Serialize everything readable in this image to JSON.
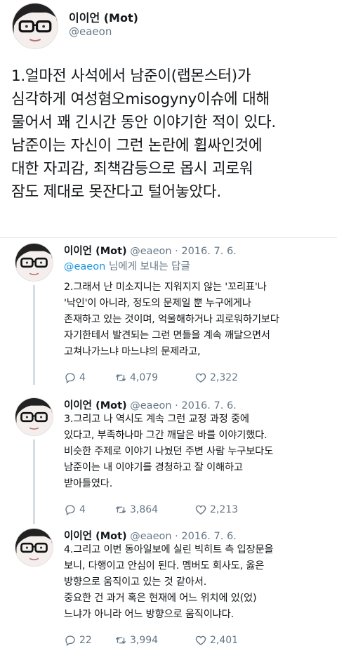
{
  "main": {
    "name": "이이언 (Mot)",
    "handle": "@eaeon",
    "text": "1.얼마전 사석에서 남준이(랩몬스터)가\n심각하게 여성혐오misogyny이슈에 대해\n물어서 꽤 긴시간 동안 이야기한 적이 있다.\n남준이는 자신이 그런 논란에 휩싸인것에\n대한 자괴감, 죄책감등으로 몹시 괴로워\n잠도 제대로 못잔다고 털어놓았다."
  },
  "replies": [
    {
      "name": "이이언 (Mot)",
      "meta": "@eaeon · 2016. 7. 6.",
      "reply_to_mention": "@eaeon",
      "reply_to_rest": " 님에게 보내는 답글",
      "text": "2.그래서 난 미소지니는 지워지지 않는 '꼬리표'나\n'낙인'이 아니라, 정도의 문제일 뿐 누구에게나\n존재하고 있는 것이며, 억울해하거나 괴로워하기보다\n자기한테서 발견되는 그런 면들을 계속 깨달으면서\n고쳐나가느냐 마느냐의 문제라고,",
      "replies_count": "4",
      "retweets": "4,079",
      "likes": "2,322"
    },
    {
      "name": "이이언 (Mot)",
      "meta": "@eaeon · 2016. 7. 6.",
      "text": "3.그리고 나 역시도 계속 그런 교정 과정 중에\n있다고, 부족하나마 그간 깨달은 바를 이야기했다.\n비슷한 주제로 이야기 나눴던 주변 사람 누구보다도\n남준이는 내 이야기를 경청하고 잘 이해하고\n받아들였다.",
      "replies_count": "4",
      "retweets": "3,864",
      "likes": "2,213"
    },
    {
      "name": "이이언 (Mot)",
      "meta": "@eaeon · 2016. 7. 6.",
      "text": "4.그리고 이번 동아일보에 실린 빅히트 측 입장문을\n보니, 다행이고 안심이 된다. 멤버도 회사도, 옳은\n방향으로 움직이고 있는 것 같아서.\n중요한 건 과거 혹은 현재에 어느 위치에 있(었)\n느냐가 아니라 어느 방향으로 움직이냐다.",
      "replies_count": "22",
      "retweets": "3,994",
      "likes": "2,401"
    }
  ],
  "colors": {
    "text": "#14171a",
    "muted": "#657786",
    "link": "#1b95e0",
    "divider": "#e1e8ed"
  },
  "icons": [
    "avatar",
    "reply-icon",
    "retweet-icon",
    "like-icon"
  ]
}
